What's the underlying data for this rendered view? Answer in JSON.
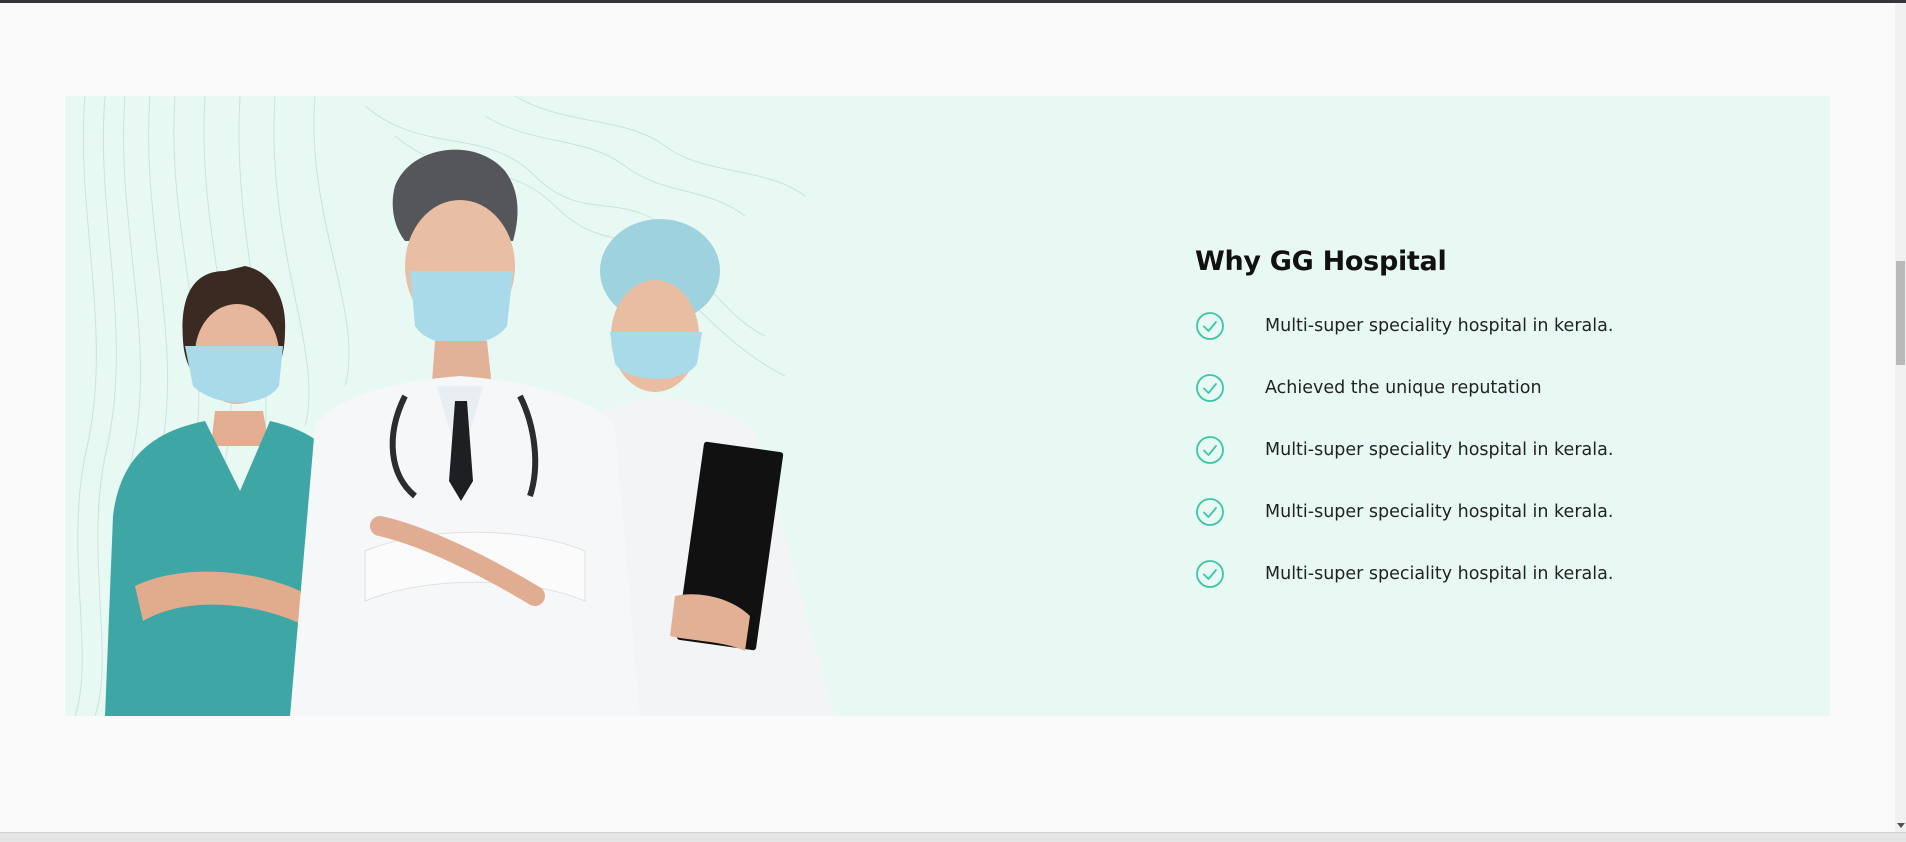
{
  "section": {
    "title": "Why GG Hospital",
    "features": [
      {
        "text": "Multi-super speciality hospital in kerala.",
        "icon": "check-circle-icon"
      },
      {
        "text": "Achieved the unique reputation",
        "icon": "check-circle-icon"
      },
      {
        "text": "Multi-super speciality hospital in kerala.",
        "icon": "check-circle-icon"
      },
      {
        "text": "Multi-super speciality hospital in kerala.",
        "icon": "check-circle-icon"
      },
      {
        "text": "Multi-super speciality hospital in kerala.",
        "icon": "check-circle-icon"
      }
    ]
  },
  "image": {
    "subject": "doctors-photo"
  },
  "colors": {
    "page_bg": "#fafafa",
    "hero_bg": "#e8f9f4",
    "accent": "#3cc6a6",
    "title": "#111111",
    "text": "#222222"
  }
}
